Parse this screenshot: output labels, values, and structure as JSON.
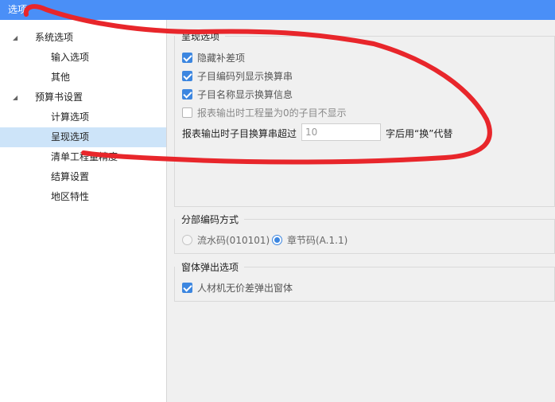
{
  "window": {
    "title": "选项"
  },
  "tree": [
    {
      "label": "系统选项",
      "level": 0,
      "expanded": true
    },
    {
      "label": "输入选项",
      "level": 1
    },
    {
      "label": "其他",
      "level": 1
    },
    {
      "label": "预算书设置",
      "level": 0,
      "expanded": true
    },
    {
      "label": "计算选项",
      "level": 1
    },
    {
      "label": "呈现选项",
      "level": 1,
      "selected": true
    },
    {
      "label": "清单工程量精度",
      "level": 1
    },
    {
      "label": "结算设置",
      "level": 1
    },
    {
      "label": "地区特性",
      "level": 1
    }
  ],
  "display_options": {
    "title": "呈现选项",
    "checkboxes": [
      {
        "label": "隐藏补差项",
        "checked": true
      },
      {
        "label": "子目编码列显示换算串",
        "checked": true
      },
      {
        "label": "子目名称显示换算信息",
        "checked": true
      },
      {
        "label": "报表输出时工程量为0的子目不显示",
        "checked": false
      }
    ],
    "exceed_prefix": "报表输出时子目换算串超过",
    "exceed_value": "10",
    "exceed_suffix": "字后用“换”代替"
  },
  "coding_method": {
    "title": "分部编码方式",
    "options": [
      {
        "label": "流水码(010101)",
        "selected": false
      },
      {
        "label": "章节码(A.1.1)",
        "selected": true
      }
    ]
  },
  "popup_options": {
    "title": "窗体弹出选项",
    "checkboxes": [
      {
        "label": "人材机无价差弹出窗体",
        "checked": true
      }
    ]
  },
  "colors": {
    "titlebar": "#4a8ff7",
    "selected_row": "#cde4f9",
    "accent": "#3c86e0",
    "annotation": "#e8262b"
  }
}
